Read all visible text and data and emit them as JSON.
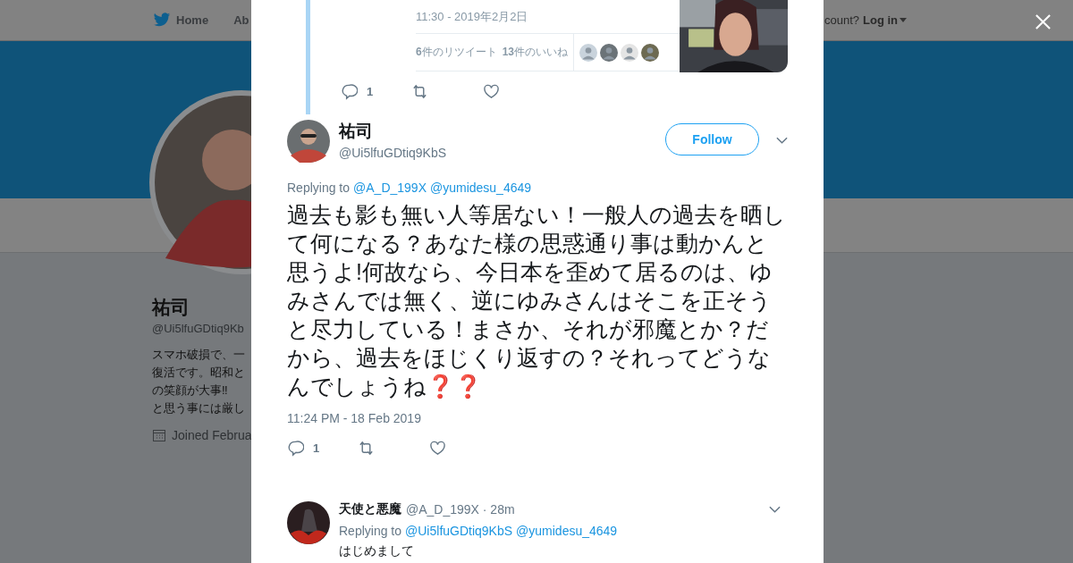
{
  "header": {
    "nav": [
      {
        "label": "Home",
        "kind": "home"
      },
      {
        "label": "Ab",
        "kind": "plain"
      }
    ],
    "account_prompt": "count?",
    "login": "Log in"
  },
  "profile": {
    "name": "祐司",
    "handle": "@Ui5lfuGDtiq9Kb",
    "bio_lines": [
      "スマホ破損で、一",
      "復活です。昭和と",
      "の笑顔が大事‼",
      "と思う事には厳し"
    ],
    "joined": "Joined Februa"
  },
  "quoted_tail": {
    "time": "11:30 - 2019年2月2日",
    "retweets": "**6**件のリツイート",
    "likes": "**13**件のいいね",
    "replies": "1"
  },
  "tweet": {
    "name": "祐司",
    "handle": "@Ui5lfuGDtiq9KbS",
    "follow": "Follow",
    "replying_to": "Replying to",
    "mentions": [
      "@A_D_199X",
      "@yumidesu_4649"
    ],
    "text": "過去も影も無い人等居ない！一般人の過去を晒して何になる？あなた様の思惑通り事は動かんと思うよ!何故なら、今日本を歪めて居るのは、ゆみさんでは無く、逆にゆみさんはそこを正そうと尽力している！まさか、それが邪魔とか？だから、過去をほじくり返すの？それってどうなんでしょうね❓❓",
    "time": "11:24 PM - 18 Feb 2019",
    "replies": "1"
  },
  "reply": {
    "name": "天使と悪魔",
    "meta": "@A_D_199X · 28m",
    "replying_to": "Replying to",
    "mentions": [
      "@Ui5lfuGDtiq9KbS",
      "@yumidesu_4649"
    ],
    "text": "はじめまして"
  }
}
